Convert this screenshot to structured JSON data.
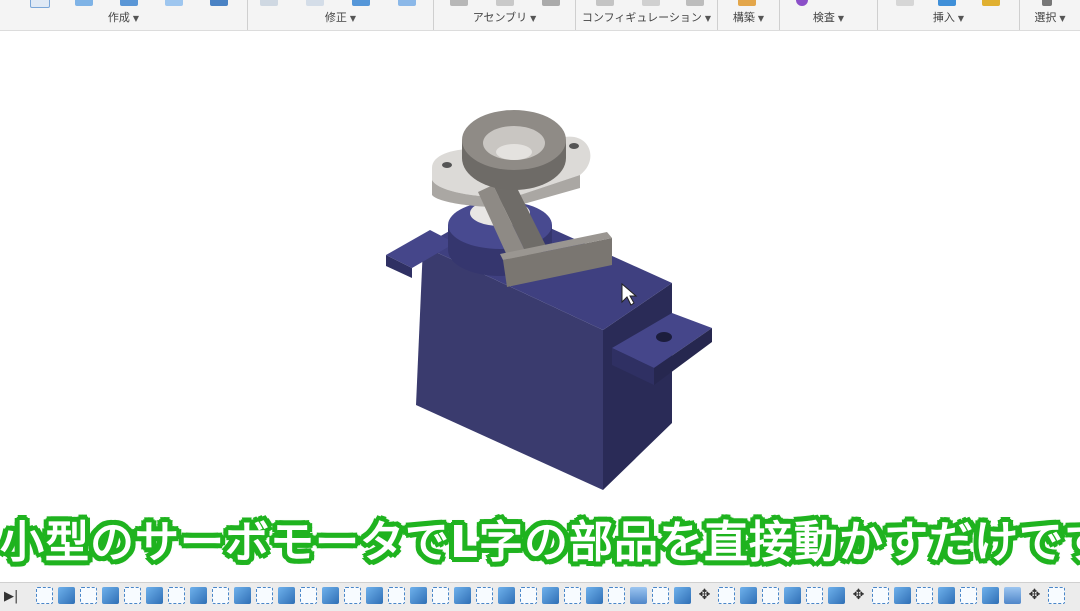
{
  "toolbar": {
    "groups": [
      {
        "label": "作成"
      },
      {
        "label": "修正"
      },
      {
        "label": "アセンブリ"
      },
      {
        "label": "コンフィギュレーション"
      },
      {
        "label": "構築"
      },
      {
        "label": "検査"
      },
      {
        "label": "挿入"
      },
      {
        "label": "選択"
      }
    ]
  },
  "subtitle": "小型のサーボモータでL字の部品を直接動かすだけです",
  "colors": {
    "servo_body": "#333466",
    "servo_top": "#3e3f7a",
    "arm": "#8a8680",
    "subtitle_outline": "#1fb31f"
  },
  "timeline": {
    "items": [
      "sketch",
      "solid",
      "sketch",
      "solid",
      "sketch",
      "solid",
      "sketch",
      "solid",
      "sketch",
      "solid",
      "sketch",
      "solid",
      "sketch",
      "solid",
      "sketch",
      "solid",
      "sketch",
      "solid",
      "sketch",
      "solid",
      "sketch",
      "solid",
      "sketch",
      "solid",
      "sketch",
      "solid",
      "sketch",
      "plane",
      "sketch",
      "solid",
      "move",
      "sketch",
      "solid",
      "sketch",
      "solid",
      "sketch",
      "solid",
      "move",
      "sketch",
      "solid",
      "sketch",
      "solid",
      "sketch",
      "solid",
      "plane",
      "move",
      "sketch",
      "joint",
      "joint",
      "joint"
    ]
  }
}
